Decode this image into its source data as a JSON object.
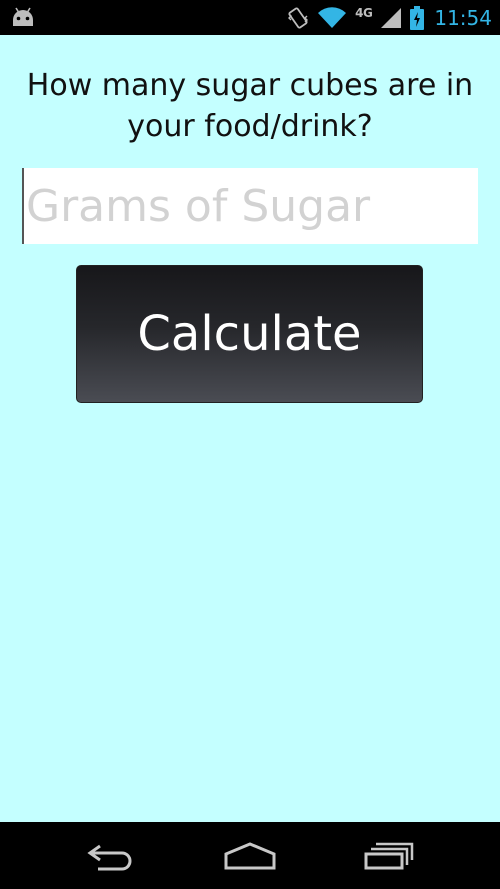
{
  "status_bar": {
    "network_type": "4G",
    "time": "11:54",
    "icons": [
      "android-icon",
      "vibrate-icon",
      "wifi-icon",
      "signal-icon",
      "battery-charging-icon"
    ]
  },
  "main": {
    "question": "How many sugar cubes are in your food/drink?",
    "grams_input": {
      "value": "",
      "placeholder": "Grams of Sugar"
    },
    "calculate_label": "Calculate"
  },
  "nav_bar": {
    "icons": [
      "back-icon",
      "home-icon",
      "recent-apps-icon"
    ]
  },
  "colors": {
    "background": "#c4ffff",
    "status_accent": "#33b5e5",
    "button_dark": "#26272b"
  }
}
